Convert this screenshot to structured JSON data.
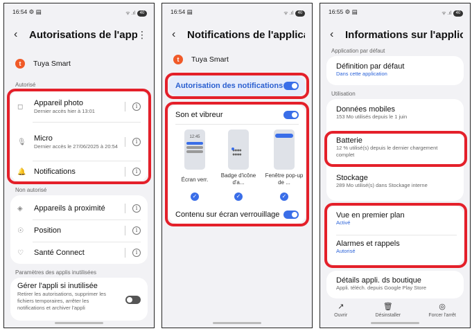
{
  "phone1": {
    "time": "16:54",
    "status_icons": "⚙ ▤",
    "signal": "ᯤ .ıl",
    "battery": "40",
    "title": "Autorisations de l'appli...",
    "app_name": "Tuya Smart",
    "section_allowed": "Autorisé",
    "camera_label": "Appareil photo",
    "camera_sub": "Dernier accès hier à 13:01",
    "mic_label": "Micro",
    "mic_sub": "Dernier accès le 27/06/2025 à 20:54",
    "notif_label": "Notifications",
    "section_denied": "Non autorisé",
    "nearby_label": "Appareils à proximité",
    "location_label": "Position",
    "health_label": "Santé Connect",
    "section_unused": "Paramètres des applis inutilisées",
    "unused_label": "Gérer l'appli si inutilisée",
    "unused_sub": "Retirer les autorisations, supprimer les fichiers temporaires, arrêter les notifications et archiver l'appli"
  },
  "phone2": {
    "time": "16:54",
    "status_icons": "▤",
    "signal": "ᯤ .ıl",
    "battery": "40",
    "title": "Notifications de l'applicati...",
    "app_name": "Tuya Smart",
    "allow_label": "Autorisation des notifications",
    "sound_label": "Son et vibreur",
    "preview_time": "12:45",
    "style_lock": "Écran verr.",
    "style_badge": "Badge d'icône d'a...",
    "style_popup": "Fenêtre pop-up de ...",
    "lockscreen_label": "Contenu sur écran verrouillage"
  },
  "phone3": {
    "time": "16:55",
    "status_icons": "⚙ ▤",
    "signal": "ᯤ .ıl",
    "battery": "40",
    "title": "Informations sur l'applicat...",
    "section_default": "Application par défaut",
    "default_label": "Définition par défaut",
    "default_sub": "Dans cette application",
    "section_usage": "Utilisation",
    "data_label": "Données mobiles",
    "data_sub": "153 Mo utilisés depuis le 1 juin",
    "battery_label": "Batterie",
    "battery_sub": "12 % utilisé(s) depuis le dernier chargement complet",
    "storage_label": "Stockage",
    "storage_sub": "289 Mo utilisé(s) dans Stockage interne",
    "foreground_label": "Vue en premier plan",
    "foreground_sub": "Activé",
    "alarms_label": "Alarmes et rappels",
    "alarms_sub": "Autorisé",
    "store_label": "Détails appli. ds boutique",
    "store_sub": "Appli. téléch. depuis Google Play Store",
    "open_label": "Ouvrir",
    "uninstall_label": "Désinstaller",
    "force_stop_label": "Forcer l'arrêt"
  },
  "colors": {
    "accent": "#3a6ee8",
    "highlight": "#e4202a",
    "brand": "#f05a28"
  },
  "icons": [
    "camera-icon",
    "mic-icon",
    "bell-icon",
    "nearby-icon",
    "location-icon",
    "health-icon",
    "info-icon",
    "back-icon",
    "more-icon",
    "open-icon",
    "trash-icon",
    "stop-icon"
  ]
}
